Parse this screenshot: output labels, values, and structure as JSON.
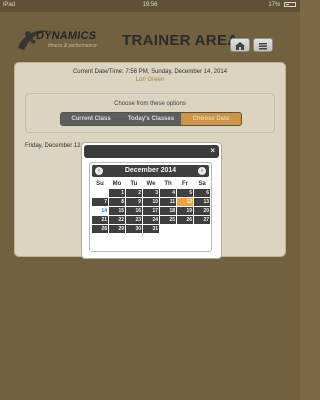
{
  "status": {
    "device": "iPad",
    "time": "19:56",
    "battery": "17%"
  },
  "header": {
    "brand": "DYNAMICS",
    "tagline": "fitness & performance",
    "title": "TRAINER AREA",
    "icons": {
      "home": "home-icon",
      "menu": "menu-icon"
    }
  },
  "panel": {
    "datetime": "Current Date/Time: 7:56 PM, Sunday, December 14, 2014",
    "location": "Lori Green",
    "choose_label": "Choose from these options",
    "options": [
      "Current Class",
      "Today's Classes",
      "Choose Date"
    ],
    "active_option": "Choose Date",
    "date_value": "Friday, December 12"
  },
  "calendar": {
    "month": "December 2014",
    "prev_icon": "chevron-left-icon",
    "next_icon": "chevron-right-icon",
    "close_label": "×",
    "weekdays": [
      "Su",
      "Mo",
      "Tu",
      "We",
      "Th",
      "Fr",
      "Sa"
    ],
    "weeks": [
      [
        "",
        "1",
        "2",
        "3",
        "4",
        "5",
        "6"
      ],
      [
        "7",
        "8",
        "9",
        "10",
        "11",
        "12",
        "13"
      ],
      [
        "14",
        "15",
        "16",
        "17",
        "18",
        "19",
        "20"
      ],
      [
        "21",
        "22",
        "23",
        "24",
        "25",
        "26",
        "27"
      ],
      [
        "28",
        "29",
        "30",
        "31",
        "",
        "",
        ""
      ]
    ],
    "highlight_day": "12",
    "today_day": "14",
    "colors": {
      "highlight": "#f2a13a",
      "today_text": "#3a7fb8",
      "cell": "#3f3f3f"
    }
  }
}
